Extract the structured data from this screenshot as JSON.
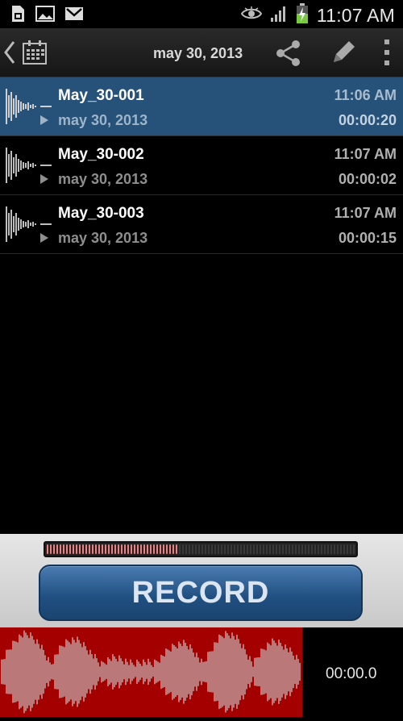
{
  "status_bar": {
    "time": "11:07 AM",
    "icons": [
      "sd-card-icon",
      "image-icon",
      "gmail-icon",
      "eye-icon",
      "signal-icon",
      "battery-charging-icon"
    ]
  },
  "action_bar": {
    "title": "may 30, 2013",
    "icons": [
      "back-icon",
      "calendar-icon",
      "share-icon",
      "pencil-icon",
      "overflow-menu-icon"
    ]
  },
  "recordings": [
    {
      "name": "May_30-001",
      "date": "may 30, 2013",
      "time": "11:06 AM",
      "duration": "00:00:20",
      "selected": true
    },
    {
      "name": "May_30-002",
      "date": "may 30, 2013",
      "time": "11:07 AM",
      "duration": "00:00:02",
      "selected": false
    },
    {
      "name": "May_30-003",
      "date": "may 30, 2013",
      "time": "11:07 AM",
      "duration": "00:00:15",
      "selected": false
    }
  ],
  "record_panel": {
    "button_label": "RECORD",
    "level_fraction": 0.43
  },
  "bottom": {
    "elapsed": "00:00.0"
  },
  "colors": {
    "selected_row": "#26527a",
    "record_button": "#1f4f80",
    "waveform_bg": "#a50000",
    "meter_on": "#f08080"
  }
}
